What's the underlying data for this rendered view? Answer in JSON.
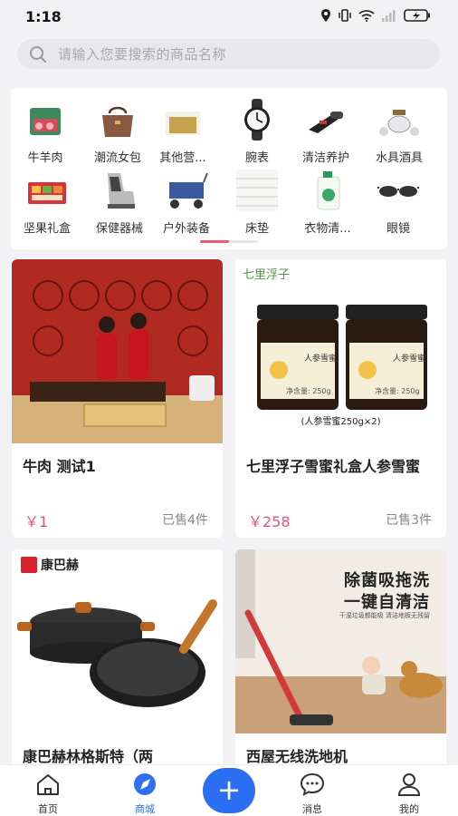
{
  "status_bar": {
    "time": "1:18"
  },
  "search": {
    "placeholder": "请输入您要搜索的商品名称"
  },
  "categories": [
    {
      "label": "牛羊肉"
    },
    {
      "label": "潮流女包"
    },
    {
      "label": "其他营..."
    },
    {
      "label": "腕表"
    },
    {
      "label": "清洁养护"
    },
    {
      "label": "水具酒具"
    },
    {
      "label": "坚果礼盒"
    },
    {
      "label": "保健器械"
    },
    {
      "label": "户外装备"
    },
    {
      "label": "床垫"
    },
    {
      "label": "衣物清..."
    },
    {
      "label": "眼镜"
    }
  ],
  "products": [
    {
      "name": "牛肉 测试1",
      "price": "￥1",
      "sold": "已售4件"
    },
    {
      "name": "七里浮子雪蜜礼盒人参雪蜜",
      "price": "￥258",
      "sold": "已售3件",
      "brand": "七里浮子",
      "caption": "(人参雪蜜250g×2)",
      "jar_label": "人参雪蜜",
      "jar_weight": "净含量: 250g"
    },
    {
      "name": "康巴赫林格斯特（两",
      "brand": "康巴赫"
    },
    {
      "name": "西屋无线洗地机",
      "headline1": "除菌吸拖洗",
      "headline2": "一键自清洁",
      "subline": "干湿垃圾都能吸 清洁地板无残留"
    }
  ],
  "tabbar": [
    {
      "label": "首页"
    },
    {
      "label": "商城"
    },
    {
      "label": "+"
    },
    {
      "label": "消息"
    },
    {
      "label": "我的"
    }
  ],
  "colors": {
    "accent": "#2d6ff2",
    "price": "#e8537a",
    "indicator": "#f05a78"
  }
}
